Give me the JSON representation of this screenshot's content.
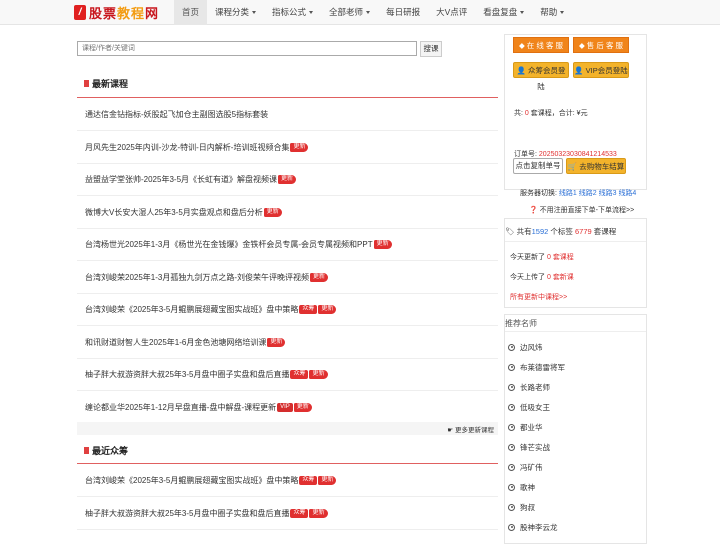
{
  "brand": {
    "logo_text_a": "股票",
    "logo_text_b": "教程",
    "logo_text_c": "网"
  },
  "nav": [
    {
      "label": "首页",
      "caret": false,
      "active": true
    },
    {
      "label": "课程分类",
      "caret": true
    },
    {
      "label": "指标公式",
      "caret": true
    },
    {
      "label": "全部老师",
      "caret": true
    },
    {
      "label": "每日研报",
      "caret": false
    },
    {
      "label": "大V点评",
      "caret": false
    },
    {
      "label": "看盘复盘",
      "caret": true
    },
    {
      "label": "帮助",
      "caret": true
    }
  ],
  "search": {
    "placeholder": "课程/作者/关键词",
    "button": "搜课"
  },
  "latest": {
    "title": "最新课程",
    "items": [
      {
        "text": "通达信金钻指标-妖股起飞加仓主副图选股5指标套装",
        "badges": []
      },
      {
        "text": "月风先生2025年内训-沙龙-特训-日内解析-培训班视频合集",
        "badges": [
          "更新"
        ]
      },
      {
        "text": "益盟益学堂张帅-2025年3-5月《长虹有道》解盘视频课",
        "badges": [
          "更新"
        ]
      },
      {
        "text": "微博大V长安大湿人25年3-5月实盘观点和盘后分析",
        "badges": [
          "更新"
        ]
      },
      {
        "text": "台湾杨世光2025年1-3月《杨世光在金钱爆》金铁杆会员专属-会员专属视频和PPT",
        "badges": [
          "更新"
        ]
      },
      {
        "text": "台湾刘峻荣2025年1-3月孤独九剑万点之路-刘俊荣午评晚评视频",
        "badges": [
          "更新"
        ]
      },
      {
        "text": "台湾刘峻荣《2025年3-5月鲲鹏展翅藏宝图实战班》盘中策略",
        "badges": [
          "众筹",
          "更新"
        ]
      },
      {
        "text": "和讯财道财智人生2025年1-6月金色池塘网络培训课",
        "badges": [
          "更新"
        ]
      },
      {
        "text": "柚子胖大叔游资胖大叔25年3-5月盘中圈子实盘和盘后直播",
        "badges": [
          "众筹",
          "更新"
        ]
      },
      {
        "text": "缠论都业华2025年1-12月早盘直播-盘中解盘-课程更新",
        "badges": [
          "VIP",
          "更新"
        ]
      }
    ],
    "more": "更多更新课程"
  },
  "crowd": {
    "title": "最近众筹",
    "items": [
      {
        "text": "台湾刘峻荣《2025年3-5月鲲鹏展翅藏宝图实战班》盘中策略",
        "badges": [
          "众筹",
          "更新"
        ]
      },
      {
        "text": "柚子胖大叔游资胖大叔25年3-5月盘中圈子实盘和盘后直播",
        "badges": [
          "众筹",
          "更新"
        ]
      }
    ]
  },
  "side": {
    "online_service": "在 线 客 服",
    "after_sales": "售 后 客 服",
    "member_login": "众筹会员登陆",
    "vip_login": "VIP会员登陆",
    "cart_prefix": "共:",
    "cart_count": "0",
    "cart_mid": "套课程，合计:",
    "cart_total": "¥元",
    "order_label": "订单号:",
    "order_no": "20250323030841214533",
    "copy_order": "点击复制单号",
    "checkout": "去购物车结算",
    "server_label": "服务器切换:",
    "servers": [
      "线路1",
      "线路2",
      "线路3",
      "线路4"
    ],
    "help_link": "不用注册直接下单-下单流程>>",
    "stats_prefix": "共有",
    "stats_tags": "1592",
    "stats_mid": "个标签",
    "stats_courses": "6779",
    "stats_suffix": "套课程",
    "today_updated_prefix": "今天更新了",
    "today_updated_count": "0",
    "today_updated_suffix": "套课程",
    "today_new_prefix": "今天上传了",
    "today_new_count": "0",
    "today_new_suffix": "套新课",
    "all_updates": "所有更新中课程>>",
    "teachers_title": "推荐名师",
    "teachers": [
      "边风炜",
      "布莱德雷将军",
      "长路老师",
      "低吸女王",
      "都业华",
      "锋芒实战",
      "冯矿伟",
      "歌神",
      "狗叔",
      "股神李云龙"
    ]
  },
  "colors": {
    "brand_red": "#c8161d",
    "accent_orange": "#f0841a",
    "badge_red": "#e03030",
    "link_blue": "#2a6fd6"
  }
}
